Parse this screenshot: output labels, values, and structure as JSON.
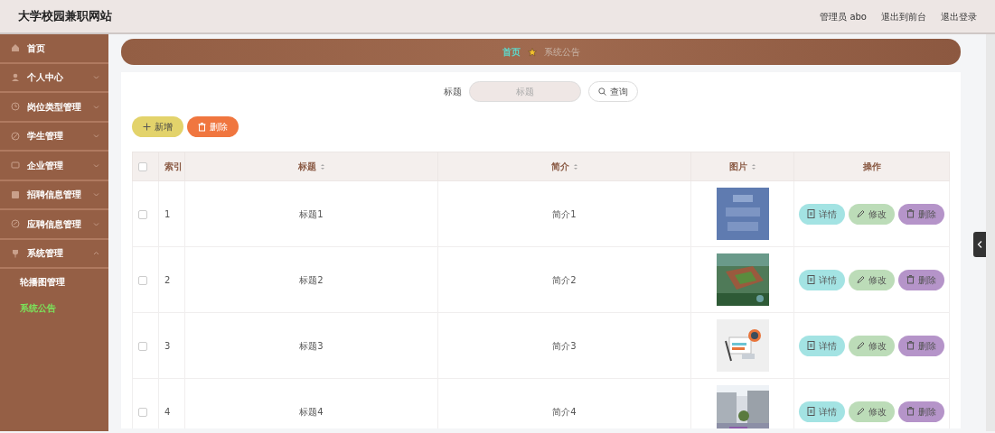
{
  "header": {
    "title": "大学校园兼职网站",
    "user": "管理员 abo",
    "links": [
      "退出到前台",
      "退出登录"
    ]
  },
  "menu": [
    {
      "label": "首页",
      "kind": "link"
    },
    {
      "label": "个人中心",
      "kind": "group",
      "expanded": false
    },
    {
      "label": "岗位类型管理",
      "kind": "group",
      "expanded": false
    },
    {
      "label": "学生管理",
      "kind": "group",
      "expanded": false
    },
    {
      "label": "企业管理",
      "kind": "group",
      "expanded": false
    },
    {
      "label": "招聘信息管理",
      "kind": "group",
      "expanded": false
    },
    {
      "label": "应聘信息管理",
      "kind": "group",
      "expanded": false
    },
    {
      "label": "系统管理",
      "kind": "group",
      "expanded": true,
      "children": [
        {
          "label": "轮播图管理",
          "selected": false
        },
        {
          "label": "系统公告",
          "selected": true
        }
      ]
    }
  ],
  "breadcrumb": [
    "首页",
    "系统公告"
  ],
  "search": {
    "label": "标题",
    "placeholder": "标题",
    "button": "查询"
  },
  "toolbar": [
    {
      "label": "新增",
      "kind": "add"
    },
    {
      "label": "删除",
      "kind": "delete"
    }
  ],
  "table": {
    "select_all": false,
    "columns": [
      {
        "label": "索引",
        "sortable": false
      },
      {
        "label": "标题",
        "sortable": true
      },
      {
        "label": "简介",
        "sortable": true
      },
      {
        "label": "图片",
        "sortable": true
      },
      {
        "label": "操作",
        "sortable": false
      }
    ],
    "rows": [
      {
        "checked": false,
        "index": "1",
        "title": "标题1",
        "intro": "简介1",
        "image": {
          "kind": "picture"
        },
        "actions": [
          {
            "label": "详情",
            "kind": "detail"
          },
          {
            "label": "修改",
            "kind": "edit"
          },
          {
            "label": "删除",
            "kind": "delete"
          }
        ]
      },
      {
        "checked": false,
        "index": "2",
        "title": "标题2",
        "intro": "简介2",
        "image": {
          "kind": "picture"
        },
        "actions": [
          {
            "label": "详情",
            "kind": "detail"
          },
          {
            "label": "修改",
            "kind": "edit"
          },
          {
            "label": "删除",
            "kind": "delete"
          }
        ]
      },
      {
        "checked": false,
        "index": "3",
        "title": "标题3",
        "intro": "简介3",
        "image": {
          "kind": "picture"
        },
        "actions": [
          {
            "label": "详情",
            "kind": "detail"
          },
          {
            "label": "修改",
            "kind": "edit"
          },
          {
            "label": "删除",
            "kind": "delete"
          }
        ]
      },
      {
        "checked": false,
        "index": "4",
        "title": "标题4",
        "intro": "简介4",
        "image": {
          "kind": "picture"
        },
        "actions": [
          {
            "label": "详情",
            "kind": "detail"
          },
          {
            "label": "修改",
            "kind": "edit"
          },
          {
            "label": "删除",
            "kind": "delete"
          }
        ]
      }
    ]
  }
}
